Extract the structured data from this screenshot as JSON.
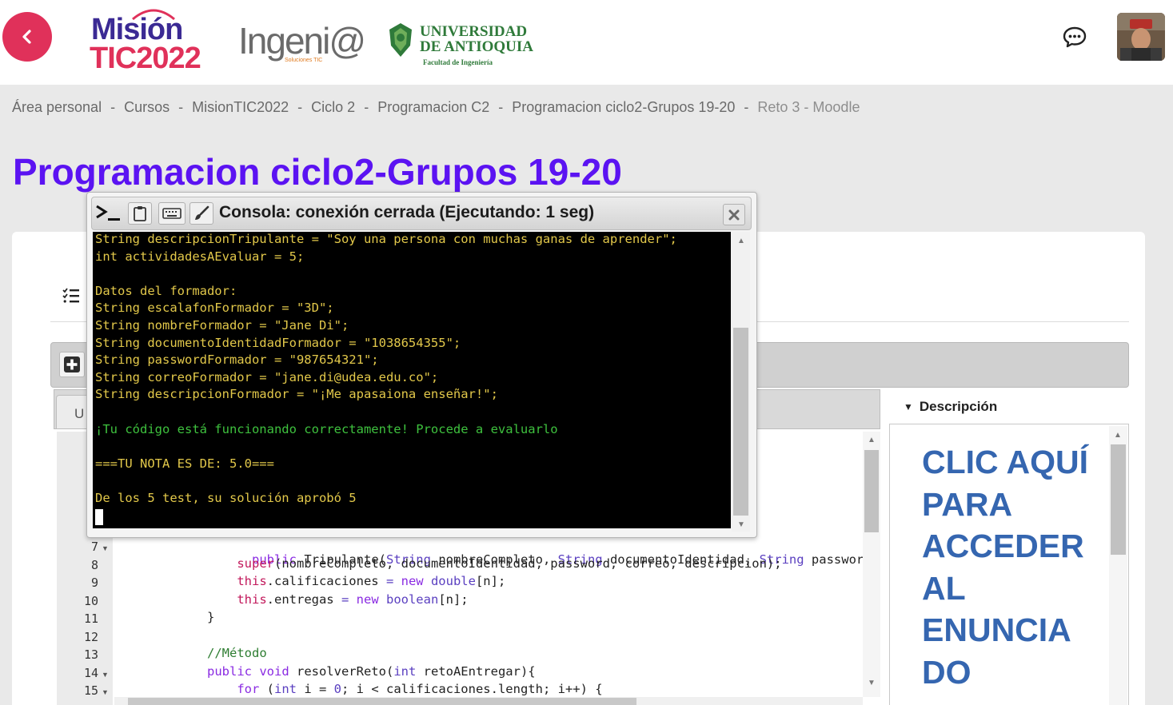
{
  "header": {
    "logo_mision": {
      "line1": "Misión",
      "line2": "TIC2022"
    },
    "logo_ingenia": {
      "name": "Ingeni@",
      "tagline": "Soluciones TIC"
    },
    "logo_udea": {
      "line1": "UNIVERSIDAD",
      "line2": "DE ANTIOQUIA",
      "line3": "Facultad de Ingeniería"
    },
    "back_icon": "chevron-left-icon",
    "chat_icon": "chat-bubble-icon",
    "brand_color": "#e0315a"
  },
  "breadcrumb": [
    {
      "label": "Área personal"
    },
    {
      "label": "Cursos"
    },
    {
      "label": "MisionTIC2022"
    },
    {
      "label": "Ciclo 2"
    },
    {
      "label": "Programacion C2"
    },
    {
      "label": "Programacion ciclo2-Grupos 19-20"
    },
    {
      "label": "Reto 3 - Moodle"
    }
  ],
  "breadcrumb_separator": "-",
  "page_title": "Programacion ciclo2-Grupos 19-20",
  "editor": {
    "tab_label": "U",
    "line_numbers": [
      "7",
      "8",
      "9",
      "10",
      "11",
      "12",
      "13",
      "14",
      "15"
    ],
    "lines": [
      "public Tripulante(String nombreCompleto, String documentoIdentidad, String password, Strin",
      "    super(nombreCompleto, documentoIdentidad, password, correo, descripcion);",
      "    this.calificaciones = new double[n];",
      "    this.entregas = new boolean[n];",
      "}",
      "",
      "//Método",
      "public void resolverReto(int retoAEntregar){",
      "    for (int i = 0; i < calificaciones.length; i++) {"
    ]
  },
  "description": {
    "header": "Descripción",
    "link_text": "CLIC AQUÍ PARA ACCEDER AL ENUNCIA DO",
    "link_color": "#3566b0"
  },
  "console": {
    "title": "Consola: conexión cerrada (Ejecutando: 1 seg)",
    "output": [
      {
        "text": "String descripcionTripulante = \"Soy una persona con muchas ganas de aprender\";",
        "color": "yellow"
      },
      {
        "text": "int actividadesAEvaluar = 5;",
        "color": "yellow"
      },
      {
        "text": "",
        "color": "yellow"
      },
      {
        "text": "Datos del formador:",
        "color": "yellow"
      },
      {
        "text": "String escalafonFormador = \"3D\";",
        "color": "yellow"
      },
      {
        "text": "String nombreFormador = \"Jane Di\";",
        "color": "yellow"
      },
      {
        "text": "String documentoIdentidadFormador = \"1038654355\";",
        "color": "yellow"
      },
      {
        "text": "String passwordFormador = \"987654321\";",
        "color": "yellow"
      },
      {
        "text": "String correoFormador = \"jane.di@udea.edu.co\";",
        "color": "yellow"
      },
      {
        "text": "String descripcionFormador = \"¡Me apasaiona enseñar!\";",
        "color": "yellow"
      },
      {
        "text": "",
        "color": "yellow"
      },
      {
        "text": "¡Tu código está funcionando correctamente! Procede a evaluarlo",
        "color": "green"
      },
      {
        "text": "",
        "color": "yellow"
      },
      {
        "text": "===TU NOTA ES DE: 5.0===",
        "color": "yellow"
      },
      {
        "text": "",
        "color": "yellow"
      },
      {
        "text": "De los 5 test, su solución aprobó 5",
        "color": "yellow"
      }
    ],
    "toolbar_icons": [
      "terminal-icon",
      "clipboard-icon",
      "keyboard-icon",
      "brush-icon"
    ],
    "close_icon": "close-icon"
  }
}
